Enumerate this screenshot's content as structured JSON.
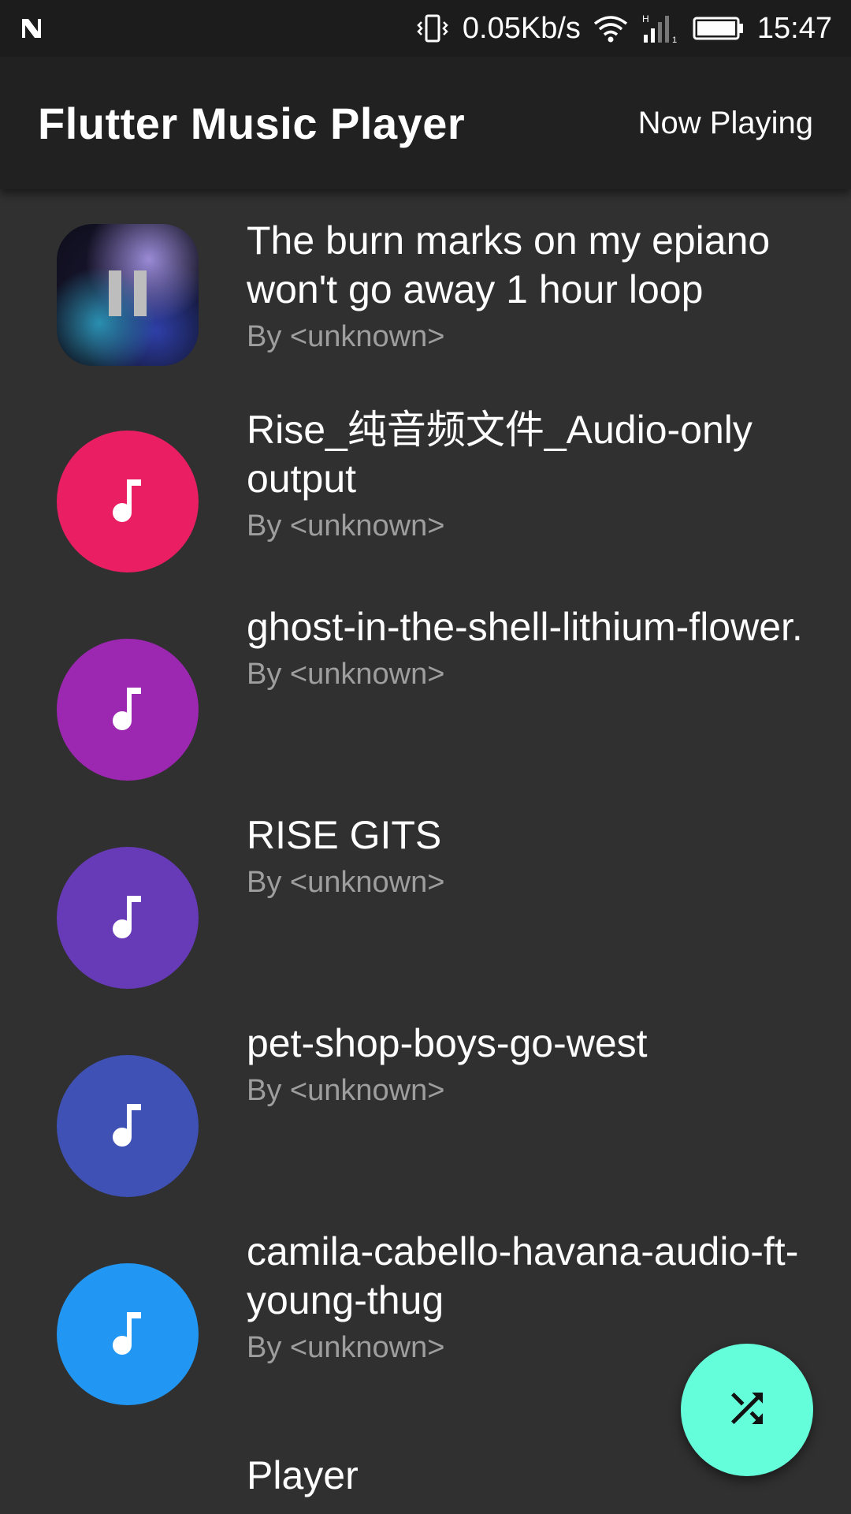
{
  "status_bar": {
    "network_speed": "0.05Kb/s",
    "time": "15:47",
    "icons": [
      "notification-n-icon",
      "vibrate-icon",
      "wifi-icon",
      "signal-icon",
      "battery-icon"
    ]
  },
  "app_bar": {
    "title": "Flutter Music Player",
    "now_playing_label": "Now Playing"
  },
  "songs": [
    {
      "title": "The burn marks on my epiano won't go away    1 hour loop",
      "artist": "By <unknown>",
      "state": "playing",
      "avatar_icon": "pause-icon"
    },
    {
      "title": "Rise_纯音频文件_Audio-only output",
      "artist": "By <unknown>",
      "color": "#e91e63",
      "avatar_icon": "music-note-icon"
    },
    {
      "title": "ghost-in-the-shell-lithium-flower.",
      "artist": "By <unknown>",
      "color": "#9c27b0",
      "avatar_icon": "music-note-icon"
    },
    {
      "title": "RISE GITS",
      "artist": "By <unknown>",
      "color": "#673ab7",
      "avatar_icon": "music-note-icon"
    },
    {
      "title": "pet-shop-boys-go-west",
      "artist": "By <unknown>",
      "color": "#3f51b5",
      "avatar_icon": "music-note-icon"
    },
    {
      "title": "camila-cabello-havana-audio-ft-young-thug",
      "artist": "By <unknown>",
      "color": "#2196f3",
      "avatar_icon": "music-note-icon"
    },
    {
      "title": "Player",
      "artist": ""
    }
  ],
  "fab": {
    "icon": "shuffle-icon",
    "color": "#64ffda"
  },
  "colors": {
    "background": "#303030",
    "app_bar": "#212121",
    "status_bar": "#1c1c1c",
    "secondary_text": "#9e9e9e"
  }
}
